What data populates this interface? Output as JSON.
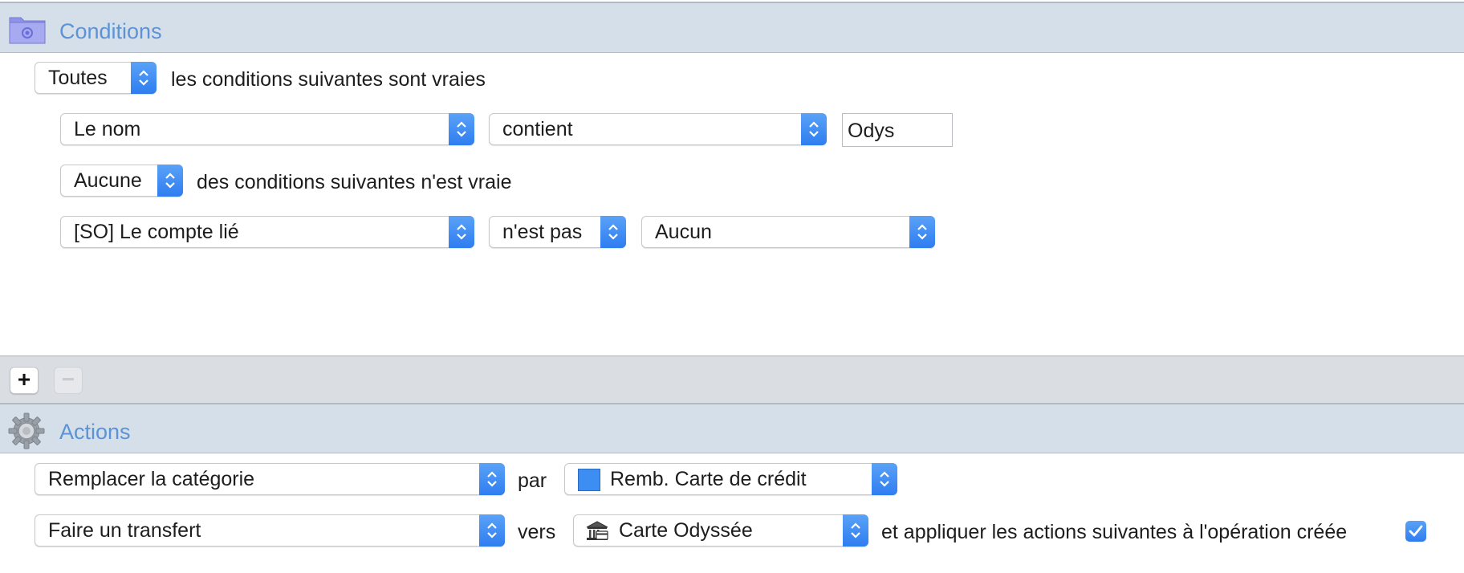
{
  "conditions": {
    "title": "Conditions",
    "match_mode": "Toutes",
    "match_text": "les conditions suivantes sont vraies",
    "rule1": {
      "field": "Le nom",
      "operator": "contient",
      "value": "Odys"
    },
    "group": {
      "match_mode": "Aucune",
      "match_text": "des conditions suivantes n'est vraie",
      "rule": {
        "field": "[SO] Le compte lié",
        "operator": "n'est pas",
        "value": "Aucun"
      }
    }
  },
  "toolbar": {
    "add_label": "+",
    "remove_label": "−"
  },
  "actions": {
    "title": "Actions",
    "action1": {
      "type": "Remplacer la catégorie",
      "connector": "par",
      "category": "Remb. Carte de crédit",
      "category_color": "#3d8ef2"
    },
    "action2": {
      "type": "Faire un transfert",
      "connector": "vers",
      "account": "Carte Odyssée",
      "account_icon": "bank-icon",
      "suffix": "et appliquer les actions suivantes à l'opération créée",
      "apply_checked": true
    }
  }
}
